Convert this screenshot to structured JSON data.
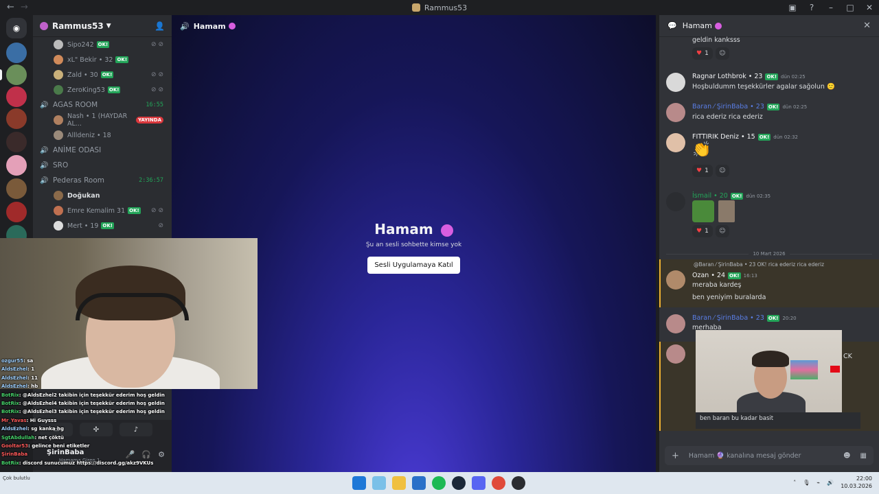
{
  "window": {
    "title": "Rammus53"
  },
  "server": {
    "name": "Rammus53",
    "members": [
      {
        "name": "Sipo242",
        "ok": "OK!"
      },
      {
        "name": "xL\" Bekir • 32",
        "ok": "OK!"
      },
      {
        "name": "Zald • 30",
        "ok": "OK!"
      },
      {
        "name": "ZeroKing53",
        "ok": "OK!"
      }
    ],
    "channels": {
      "agas": {
        "name": "AGAS ROOM",
        "timer": "16:55"
      },
      "agas_members": [
        {
          "name": "Nash • 1 (HAYDAR AL...",
          "badge": "YAYINDA"
        },
        {
          "name": "Allldeniz • 18"
        }
      ],
      "anime": "ANİME ODASI",
      "sro": "SRO",
      "pederas": {
        "name": "Pederas Room",
        "timer": "2:36:57"
      },
      "pederas_members": [
        {
          "name": "Doğukan"
        },
        {
          "name": "Emre Kemalim 31",
          "ok": "OK!"
        },
        {
          "name": "Mert • 19",
          "ok": "OK!"
        }
      ]
    }
  },
  "main": {
    "channel": "Hamam",
    "heading": "Hamam",
    "subtext": "Şu an sesli sohbette kimse yok",
    "join_button": "Sesli Uygulamaya Katıl"
  },
  "chat": {
    "header": "Hamam",
    "messages": [
      {
        "text": "geldin kanksss",
        "reaction_count": "1"
      },
      {
        "author": "Ragnar Lothbrok • 23",
        "ok": "OK!",
        "time": "dün 02:25",
        "text": "Hoşbuldumm teşekkürler agalar sağolun 🙂"
      },
      {
        "author": "Baran ⁄ ŞirinBaba • 23",
        "ok": "OK!",
        "time": "dün 02:25",
        "text": "rica ederiz rica ederiz"
      },
      {
        "author": "FITTIRIK Deniz • 15",
        "ok": "OK!",
        "time": "dün 02:32",
        "text": "👏",
        "reaction_count": "1"
      },
      {
        "author": "İsmail • 20",
        "ok": "OK!",
        "time": "dün 02:35",
        "reaction_count": "1"
      }
    ],
    "date_divider": "10 Mart 2026",
    "reply_preview": "@Baran ⁄ ŞirinBaba • 23 OK! rica ederiz rica ederiz",
    "ozan": {
      "author": "Ozan • 24",
      "ok": "OK!",
      "time": "16:13",
      "lines": [
        "meraba kardeş",
        "ben yeniyim buralarda"
      ]
    },
    "baran2": {
      "author": "Baran ⁄ ŞirinBaba • 23",
      "ok": "OK!",
      "time": "20:20",
      "text": "merhaba"
    },
    "cam_caption": "ben baran bu kadar basit",
    "cam_partial": "CK",
    "composer_placeholder": "Hamam 🔮 kanalına mesaj gönder"
  },
  "stream_chat": [
    {
      "user": "ozgur55",
      "text": ": sa"
    },
    {
      "user": "AldsEzhel",
      "text": ": 1"
    },
    {
      "user": "AldsEzhel",
      "text": ": 11"
    },
    {
      "user": "AldsEzhel",
      "text": ": hb"
    },
    {
      "user": "BotRix",
      "text": ": @AldsEzhel2 takibin için teşekkür ederim hoş geldin"
    },
    {
      "user": "BotRix",
      "text": ": @AldsEzhel4 takibin için teşekkür ederim hoş geldin"
    },
    {
      "user": "BotRix",
      "text": ": @AldsEzhel3 takibin için teşekkür ederim hoş geldin"
    },
    {
      "user": "Mr_Yavas",
      "text": ": Hi Guysss"
    },
    {
      "user": "AldsEzhel",
      "text": ": sg kanka hg"
    },
    {
      "user": "SgtAbdullah",
      "text": ": net çöktü"
    },
    {
      "user": "Gooltar53",
      "text": ": gelince beni etiketler"
    },
    {
      "user": "ŞirinBaba",
      "text": ""
    },
    {
      "user": "BotRix",
      "text": ": discord sunucumuz https://discord.gg/akz9VKUs"
    }
  ],
  "user_panel": {
    "name": "ŞirinBaba",
    "status": "Hamama Giren 1"
  },
  "taskbar": {
    "time": "22:00",
    "date": "10.03.2026",
    "weather": "Çok bulutlu"
  }
}
